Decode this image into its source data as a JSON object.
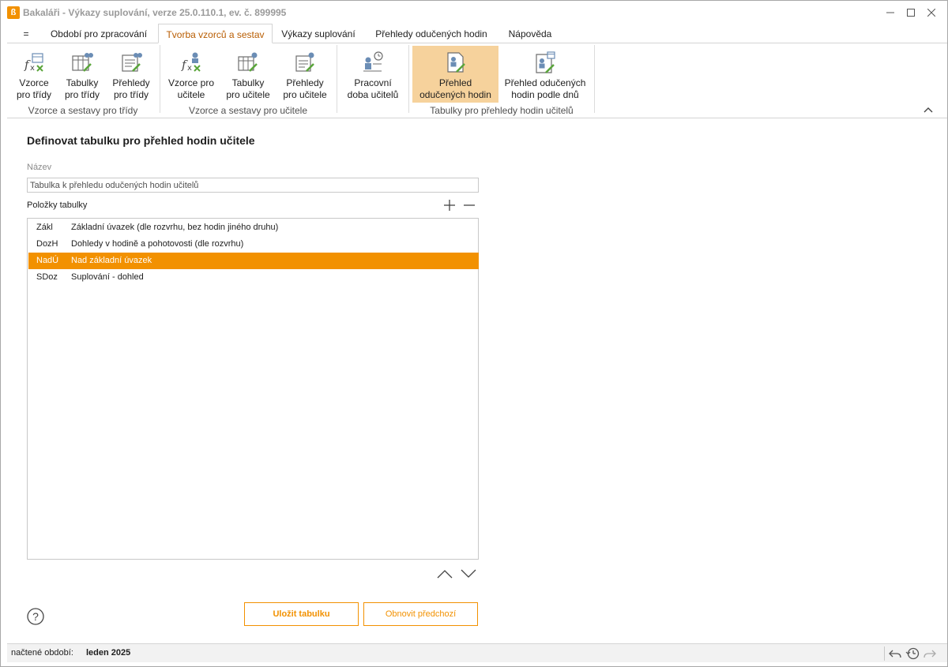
{
  "window": {
    "title": "Bakaláři - Výkazy suplování, verze 25.0.110.1, ev. č. 899995"
  },
  "tabs": [
    {
      "label": "="
    },
    {
      "label": "Období pro zpracování"
    },
    {
      "label": "Tvorba vzorců a sestav",
      "active": true
    },
    {
      "label": "Výkazy suplování"
    },
    {
      "label": "Přehledy odučených hodin"
    },
    {
      "label": "Nápověda"
    }
  ],
  "ribbon": {
    "buttons": [
      {
        "line1": "Vzorce",
        "line2": "pro třídy",
        "icon": "formula-class-icon"
      },
      {
        "line1": "Tabulky",
        "line2": "pro třídy",
        "icon": "table-class-icon"
      },
      {
        "line1": "Přehledy",
        "line2": "pro třídy",
        "icon": "report-class-icon"
      },
      {
        "line1": "Vzorce pro",
        "line2": "učitele",
        "icon": "formula-teacher-icon"
      },
      {
        "line1": "Tabulky",
        "line2": "pro učitele",
        "icon": "table-teacher-icon"
      },
      {
        "line1": "Přehledy",
        "line2": "pro učitele",
        "icon": "report-teacher-icon"
      },
      {
        "line1": "Pracovní",
        "line2": "doba učitelů",
        "icon": "working-time-icon"
      },
      {
        "line1": "Přehled",
        "line2": "odučených hodin",
        "icon": "taught-hours-icon",
        "active": true
      },
      {
        "line1": "Přehled odučených",
        "line2": "hodin podle dnů",
        "icon": "taught-hours-days-icon"
      }
    ],
    "groups": [
      {
        "label": "Vzorce a sestavy pro třídy"
      },
      {
        "label": "Vzorce a sestavy pro učitele"
      },
      {
        "label": "Tabulky pro přehledy hodin učitelů"
      }
    ]
  },
  "main": {
    "title": "Definovat tabulku pro přehled hodin učitele",
    "name_label": "Název",
    "name_value": "Tabulka k přehledu odučených hodin učitelů",
    "items_label": "Položky tabulky",
    "items": [
      {
        "code": "Zákl",
        "desc": "Základní úvazek (dle rozvrhu, bez hodin jiného druhu)",
        "selected": false
      },
      {
        "code": "DozH",
        "desc": "Dohledy v hodině a pohotovosti (dle rozvrhu)",
        "selected": false
      },
      {
        "code": "NadÚ",
        "desc": "Nad základní úvazek",
        "selected": true
      },
      {
        "code": "SDoz",
        "desc": "Suplování - dohled",
        "selected": false
      }
    ],
    "save_label": "Uložit tabulku",
    "restore_label": "Obnovit předchozí"
  },
  "status": {
    "period_label": "načtené období:",
    "period_value": "leden 2025"
  },
  "colors": {
    "accent": "#f29100",
    "active_ribbon": "#f6d29c",
    "active_tab_text": "#b85c00"
  }
}
